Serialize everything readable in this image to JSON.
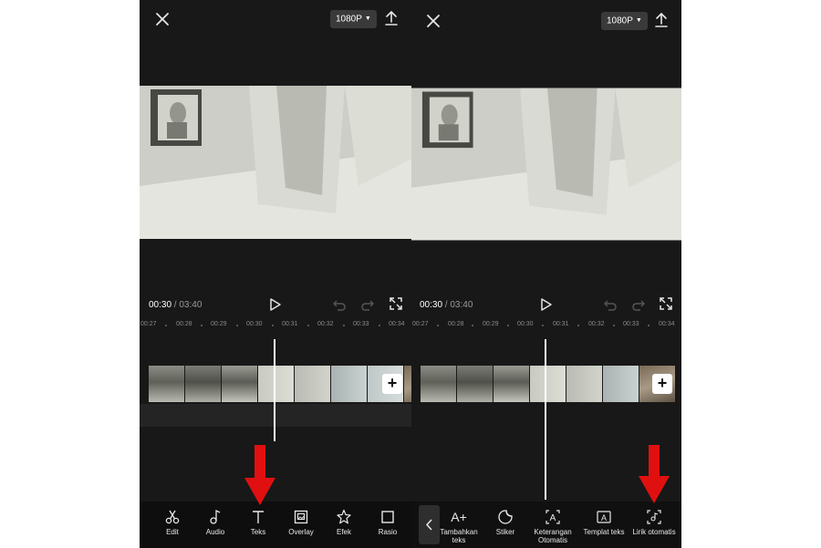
{
  "left_screen": {
    "resolution_label": "1080P",
    "timecode": {
      "current": "00:30",
      "separator": " / ",
      "total": "03:40"
    },
    "ruler_ticks": [
      "00:27",
      "00:28",
      "00:29",
      "00:30",
      "00:31",
      "00:32",
      "00:33",
      "00:34"
    ],
    "toolbar": [
      {
        "label": "Edit",
        "icon": "scissors-icon"
      },
      {
        "label": "Audio",
        "icon": "music-note-icon"
      },
      {
        "label": "Teks",
        "icon": "text-icon"
      },
      {
        "label": "Overlay",
        "icon": "overlay-icon"
      },
      {
        "label": "Efek",
        "icon": "effects-star-icon"
      },
      {
        "label": "Rasio",
        "icon": "ratio-square-icon"
      }
    ]
  },
  "right_screen": {
    "resolution_label": "1080P",
    "timecode": {
      "current": "00:30",
      "separator": " / ",
      "total": "03:40"
    },
    "ruler_ticks": [
      "00:27",
      "00:28",
      "00:29",
      "00:30",
      "00:31",
      "00:32",
      "00:33",
      "00:34"
    ],
    "toolbar": [
      {
        "label_line1": "Tambahkan",
        "label_line2": "teks",
        "icon": "add-text-icon",
        "icon_text": "A+"
      },
      {
        "label_line1": "Stiker",
        "label_line2": "",
        "icon": "sticker-icon"
      },
      {
        "label_line1": "Keterangan",
        "label_line2": "Otomatis",
        "icon": "auto-caption-icon",
        "icon_text": "A"
      },
      {
        "label_line1": "Templat teks",
        "label_line2": "",
        "icon": "text-template-icon",
        "icon_text": "A"
      },
      {
        "label_line1": "Lirik otomatis",
        "label_line2": "",
        "icon": "auto-lyrics-icon"
      }
    ]
  },
  "colors": {
    "background": "#181818",
    "toolbar_background": "#0e0e0e",
    "arrow": "#e01010",
    "playhead": "#ffffff",
    "button": "#3a3a3a"
  }
}
